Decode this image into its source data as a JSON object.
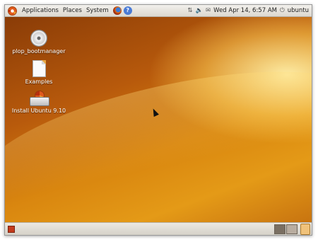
{
  "top_panel": {
    "menus": [
      "Applications",
      "Places",
      "System"
    ],
    "clock": "Wed Apr 14,  6:57 AM",
    "user": "ubuntu"
  },
  "desktop": {
    "icons": [
      {
        "label": "plop_bootmanager",
        "icon": "dvd-disc-icon"
      },
      {
        "label": "Examples",
        "icon": "document-icon"
      },
      {
        "label": "Install Ubuntu 9.10",
        "icon": "installer-icon"
      }
    ]
  },
  "colors": {
    "wallpaper_dark": "#8a3c07",
    "wallpaper_light": "#e49a17",
    "panel": "#e6e2da"
  }
}
